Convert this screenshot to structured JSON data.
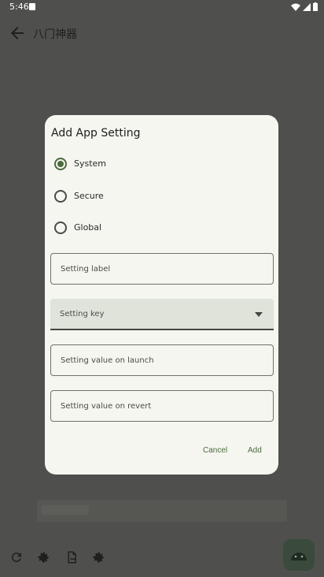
{
  "status_bar": {
    "time": "5:46"
  },
  "app": {
    "title": "八门神器"
  },
  "dialog": {
    "title": "Add App Setting",
    "radio_options": [
      {
        "label": "System",
        "checked": true
      },
      {
        "label": "Secure",
        "checked": false
      },
      {
        "label": "Global",
        "checked": false
      }
    ],
    "fields": {
      "label_placeholder": "Setting label",
      "key_placeholder": "Setting key",
      "launch_placeholder": "Setting value on launch",
      "revert_placeholder": "Setting value on revert"
    },
    "buttons": {
      "cancel": "Cancel",
      "add": "Add"
    }
  },
  "colors": {
    "accent": "#4c6b3e",
    "dialog_bg": "#f4f6ef",
    "scrim": "#4f504d"
  },
  "icons": {
    "back": "arrow-back-icon",
    "refresh": "refresh-icon",
    "settings": "gear-icon",
    "export": "export-icon",
    "settings_star": "gear-star-icon",
    "fab": "android-icon"
  }
}
